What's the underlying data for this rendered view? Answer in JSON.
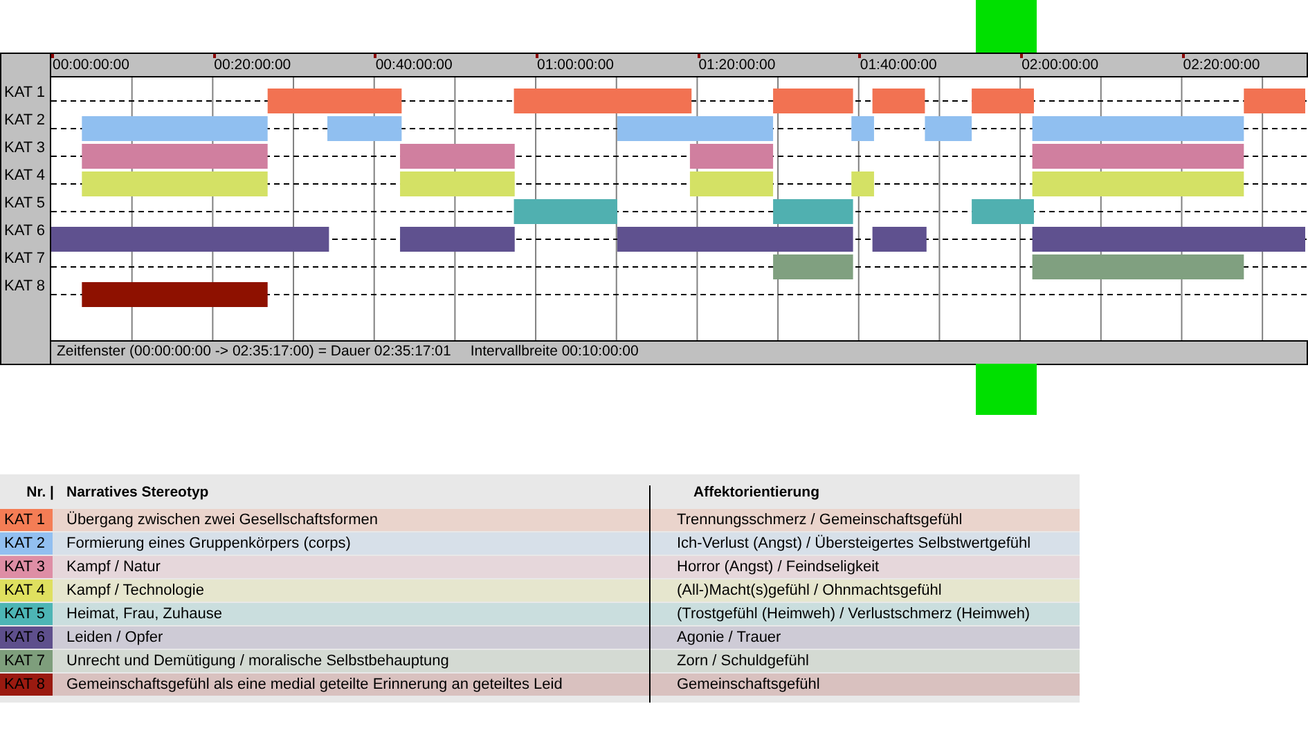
{
  "timeline": {
    "ticks": [
      "00:00:00:00",
      "00:20:00:00",
      "00:40:00:00",
      "01:00:00:00",
      "01:20:00:00",
      "01:40:00:00",
      "02:00:00:00",
      "02:20:00:00"
    ],
    "rows": [
      {
        "label": "KAT 1",
        "color": "#f27252"
      },
      {
        "label": "KAT 2",
        "color": "#90bff0"
      },
      {
        "label": "KAT 3",
        "color": "#d07f9f"
      },
      {
        "label": "KAT 4",
        "color": "#d4e165"
      },
      {
        "label": "KAT 5",
        "color": "#50b0b0"
      },
      {
        "label": "KAT 6",
        "color": "#5f518f"
      },
      {
        "label": "KAT 7",
        "color": "#80a080"
      },
      {
        "label": "KAT 8",
        "color": "#8e1100"
      }
    ],
    "status": {
      "window": "Zeitfenster (00:00:00:00 -> 02:35:17:00) = Dauer 02:35:17:01",
      "interval": "Intervallbreite 00:10:00:00"
    }
  },
  "legend": {
    "columns": [
      "Nr. |",
      "Narratives Stereotyp",
      "Affektorientierung"
    ],
    "rows": [
      {
        "nr": "KAT 1",
        "color": "#f47d55",
        "stereotype": "Übergang zwischen zwei Gesellschaftsformen",
        "affect": "Trennungsschmerz / Gemeinschaftsgefühl"
      },
      {
        "nr": "KAT 2",
        "color": "#92bff0",
        "stereotype": "Formierung eines Gruppenkörpers (corps)",
        "affect": "Ich-Verlust (Angst) / Übersteigertes Selbstwertgefühl"
      },
      {
        "nr": "KAT 3",
        "color": "#de8ea5",
        "stereotype": "Kampf / Natur",
        "affect": "Horror (Angst) / Feindseligkeit"
      },
      {
        "nr": "KAT 4",
        "color": "#dfe05f",
        "stereotype": "Kampf / Technologie",
        "affect": "(All-)Macht(s)gefühl / Ohnmachtsgefühl"
      },
      {
        "nr": "KAT 5",
        "color": "#4db5b5",
        "stereotype": "Heimat, Frau, Zuhause",
        "affect": "(Trostgefühl (Heimweh) / Verlustschmerz (Heimweh)"
      },
      {
        "nr": "KAT 6",
        "color": "#5e4f8c",
        "stereotype": "Leiden / Opfer",
        "affect": "Agonie / Trauer"
      },
      {
        "nr": "KAT 7",
        "color": "#7e9e7c",
        "stereotype": "Unrecht und Demütigung / moralische Selbstbehauptung",
        "affect": "Zorn / Schuldgefühl"
      },
      {
        "nr": "KAT 8",
        "color": "#9a1a10",
        "stereotype": "Gemeinschaftsgefühl als eine medial geteilte Erinnerung an geteiltes Leid",
        "affect": "Gemeinschaftsgefühl"
      }
    ]
  }
}
